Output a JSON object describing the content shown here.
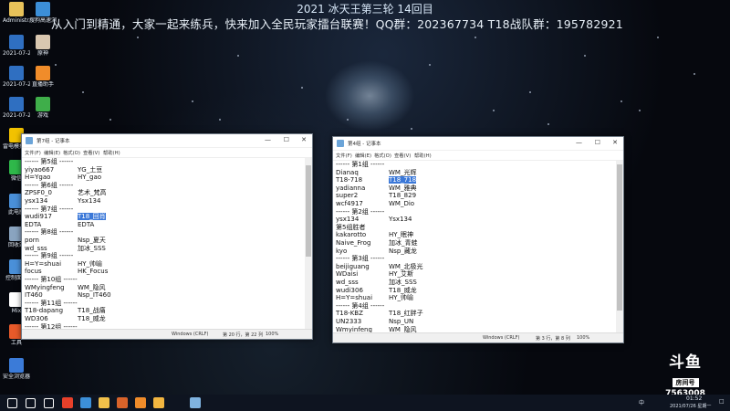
{
  "banner": {
    "line1": "2021 冰天王第三轮 14回目",
    "line2": "从入门到精通，大家一起来练兵，快来加入全民玩家擂台联赛！QQ群：202367734    T18战队群：195782921"
  },
  "desktop_icons": [
    {
      "label": "Administr...",
      "icon": "user-folder-icon",
      "color": "#e8c25a"
    },
    {
      "label": "搜狗高速浏览器",
      "icon": "browser-icon",
      "color": "#3c8fd8"
    },
    {
      "label": "2021-07-2...",
      "icon": "document-icon",
      "color": "#2f6fc1"
    },
    {
      "label": "原神",
      "icon": "game-icon",
      "color": "#d9c7b0"
    },
    {
      "label": "2021-07-2...",
      "icon": "document-icon",
      "color": "#2f6fc1"
    },
    {
      "label": "直播助手",
      "icon": "live-icon",
      "color": "#f08c2a"
    },
    {
      "label": "2021-07-2...",
      "icon": "document-icon",
      "color": "#2f6fc1"
    },
    {
      "label": "游戏",
      "icon": "tree-icon",
      "color": "#3fae4a"
    },
    {
      "label": "雷电模拟器",
      "icon": "emulator-icon",
      "color": "#f2c200"
    },
    {
      "label": "微信",
      "icon": "wechat-icon",
      "color": "#2fb84a"
    },
    {
      "label": "此电脑",
      "icon": "computer-icon",
      "color": "#4a90d9"
    },
    {
      "label": "回收站",
      "icon": "recycle-bin-icon",
      "color": "#8aa4c0"
    },
    {
      "label": "控制面板",
      "icon": "control-panel-icon",
      "color": "#4a90d9"
    },
    {
      "label": "Mix",
      "icon": "app-icon",
      "color": "#ffffff"
    },
    {
      "label": "工具",
      "icon": "tools-icon",
      "color": "#e85a2a"
    },
    {
      "label": "安全浏览器",
      "icon": "browser-icon",
      "color": "#3b7bd8"
    }
  ],
  "left_window": {
    "title": "第7组 - 记事本",
    "menu": [
      "文件(F)",
      "编辑(E)",
      "格式(O)",
      "查看(V)",
      "帮助(H)"
    ],
    "lines": [
      [
        "------ 第5组 ------",
        ""
      ],
      [
        "yiyao667",
        "YG_土豆"
      ],
      [
        "H=Ygao",
        "HY_gao"
      ],
      [
        "------ 第6组 ------",
        ""
      ],
      [
        "ZPSF0_0",
        "艺术_梵高"
      ],
      [
        "ysx134",
        "Ysx134"
      ],
      [
        "------ 第7组 ------",
        ""
      ],
      [
        "wudi917",
        "T18_回肖"
      ],
      [
        "EDTA",
        "EDTA"
      ],
      [
        "------ 第8组 ------",
        ""
      ],
      [
        "porn",
        "Nsp_夏天"
      ],
      [
        "wd_sss",
        "加冰_SSS"
      ],
      [
        "------ 第9组 ------",
        ""
      ],
      [
        "H=Y=shuai",
        "HY_帅喻"
      ],
      [
        "focus",
        "HK_Focus"
      ],
      [
        "------ 第10组 ------",
        ""
      ],
      [
        "WMyingfeng",
        "WM_隐风"
      ],
      [
        "IT460",
        "Nsp_IT460"
      ],
      [
        "------ 第11组 ------",
        ""
      ],
      [
        "T18-dapang",
        "T18_战痛"
      ],
      [
        "WD306",
        "T18_威龙"
      ],
      [
        "------ 第12组 ------",
        ""
      ]
    ],
    "status": {
      "encoding": "Windows (CRLF)",
      "position": "第 20 行，第 22 列",
      "zoom": "100%"
    }
  },
  "right_window": {
    "title": "第4组 - 记事本",
    "menu": [
      "文件(F)",
      "编辑(E)",
      "格式(O)",
      "查看(V)",
      "帮助(H)"
    ],
    "lines": [
      [
        "------ 第1组 ------",
        ""
      ],
      [
        "Dianaq",
        "WM_光辉"
      ],
      [
        "T18-718",
        "T18_718"
      ],
      [
        "yadianna",
        "WM_雅典"
      ],
      [
        "super2",
        "T18_829"
      ],
      [
        "wcf4917",
        "WM_Dio"
      ],
      [
        "------ 第2组 ------",
        ""
      ],
      [
        "ysx134",
        "Ysx134"
      ],
      [
        "第5组胜者",
        ""
      ],
      [
        "kakarotto",
        "HY_眠神"
      ],
      [
        "Naive_Frog",
        "加冰_青蛙"
      ],
      [
        "kyo",
        "Nsp_藏龙"
      ],
      [
        "------ 第3组 ------",
        ""
      ],
      [
        "beijiguang",
        "WM_北极光"
      ],
      [
        "WDaisi",
        "HY_艾斯"
      ],
      [
        "wd_sss",
        "加冰_SSS"
      ],
      [
        "wudi306",
        "T18_威龙"
      ],
      [
        "H=Y=shuai",
        "HY_帅喻"
      ],
      [
        "------ 第4组 ------",
        ""
      ],
      [
        "T18-KBZ",
        "T18_红胖子"
      ],
      [
        "UN2333",
        "Nsp_UN"
      ],
      [
        "Wmyinfeng",
        "WM_隐风"
      ]
    ],
    "status": {
      "encoding": "Windows (CRLF)",
      "position": "第 3 行，第 8 列",
      "zoom": "100%"
    }
  },
  "taskbar": {
    "apps": [
      {
        "icon": "start-icon",
        "color": "#ffffff"
      },
      {
        "icon": "search-icon",
        "color": "#ffffff"
      },
      {
        "icon": "task-view-icon",
        "color": "#ffffff"
      },
      {
        "icon": "wps-icon",
        "color": "#e8402a"
      },
      {
        "icon": "browser-icon",
        "color": "#3c8fd8"
      },
      {
        "icon": "file-explorer-icon",
        "color": "#f2c14a"
      },
      {
        "icon": "game-icon",
        "color": "#d9632a"
      },
      {
        "icon": "live-icon",
        "color": "#f08c2a"
      },
      {
        "icon": "app-icon",
        "color": "#f2b640"
      },
      {
        "icon": "notepad-icon",
        "color": "#7fb3e0"
      }
    ],
    "tray_ime": "中",
    "time": "01:52",
    "date": "2021/07/26 星期一"
  },
  "watermark": {
    "logo": "斗鱼",
    "room_label": "房间号",
    "room_number": "7563008"
  }
}
